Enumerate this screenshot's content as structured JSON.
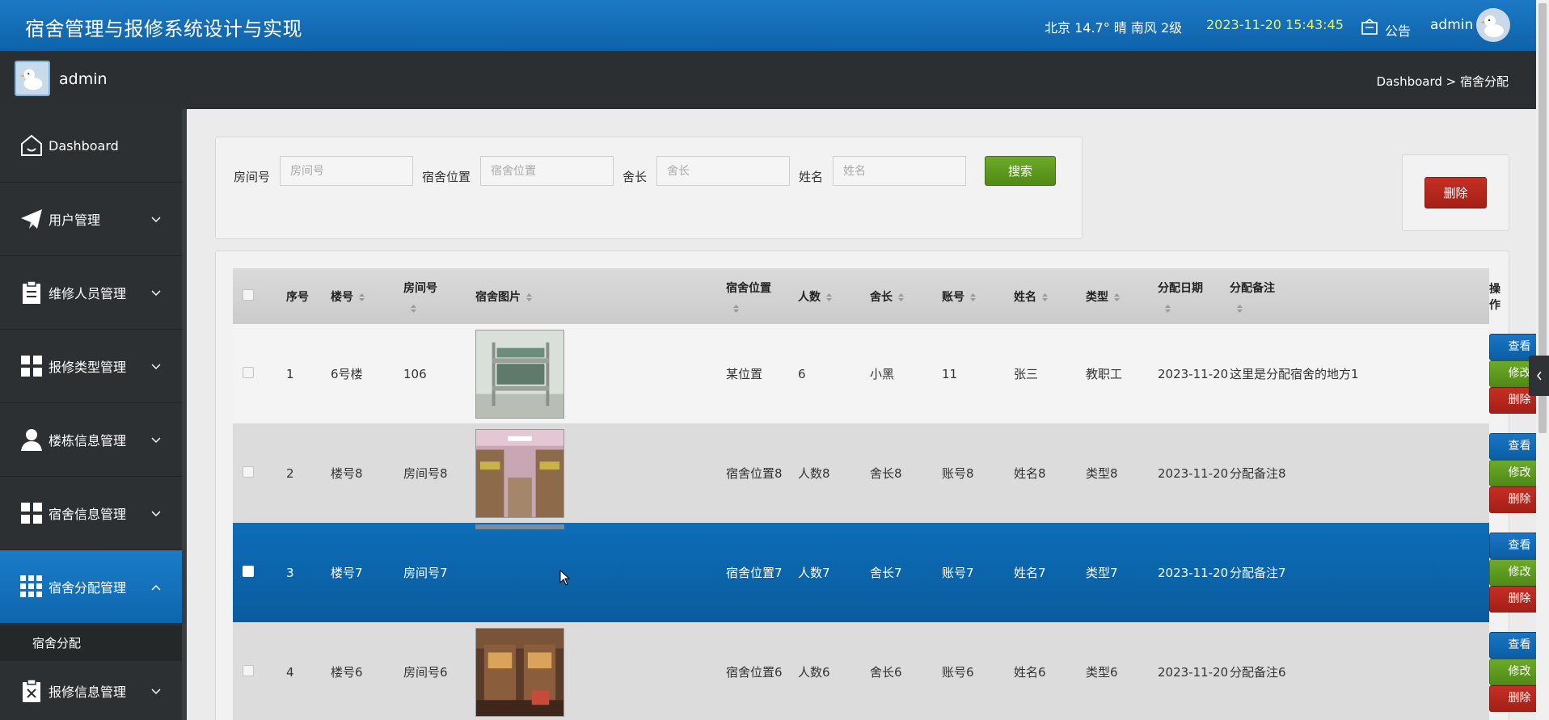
{
  "header": {
    "title": "宿舍管理与报修系统设计与实现",
    "weather": "北京  14.7°  晴  南风  2级",
    "datetime": "2023-11-20 15:43:45",
    "notice_label": "公告",
    "user": "admin"
  },
  "subbar": {
    "user": "admin",
    "breadcrumb": "Dashboard > 宿舍分配"
  },
  "sidebar": {
    "items": [
      {
        "label": "Dashboard",
        "icon": "home-icon"
      },
      {
        "label": "用户管理",
        "icon": "paper-plane-icon"
      },
      {
        "label": "维修人员管理",
        "icon": "clipboard-icon"
      },
      {
        "label": "报修类型管理",
        "icon": "grid-icon"
      },
      {
        "label": "楼栋信息管理",
        "icon": "user-icon"
      },
      {
        "label": "宿舍信息管理",
        "icon": "grid-icon"
      },
      {
        "label": "宿舍分配管理",
        "icon": "apps-icon",
        "active": true
      },
      {
        "label": "报修信息管理",
        "icon": "clipboard-x-icon"
      }
    ],
    "subitem": "宿舍分配"
  },
  "search": {
    "fields": [
      {
        "label": "房间号",
        "placeholder": "房间号"
      },
      {
        "label": "宿舍位置",
        "placeholder": "宿舍位置"
      },
      {
        "label": "舍长",
        "placeholder": "舍长"
      },
      {
        "label": "姓名",
        "placeholder": "姓名"
      }
    ],
    "button": "搜索",
    "delete_button": "删除"
  },
  "table": {
    "headers": [
      "序号",
      "楼号",
      "房间号",
      "宿舍图片",
      "宿舍位置",
      "人数",
      "舍长",
      "账号",
      "姓名",
      "类型",
      "分配日期",
      "分配备注",
      "操作"
    ],
    "actions": {
      "view": "查看",
      "edit": "修改",
      "delete": "删除"
    },
    "rows": [
      {
        "idx": "1",
        "building": "6号楼",
        "room": "106",
        "location": "某位置",
        "count": "6",
        "leader": "小黑",
        "account": "11",
        "name": "张三",
        "type": "教职工",
        "date": "2023-11-20",
        "note": "这里是分配宿舍的地方1"
      },
      {
        "idx": "2",
        "building": "楼号8",
        "room": "房间号8",
        "location": "宿舍位置8",
        "count": "人数8",
        "leader": "舍长8",
        "account": "账号8",
        "name": "姓名8",
        "type": "类型8",
        "date": "2023-11-20",
        "note": "分配备注8"
      },
      {
        "idx": "3",
        "building": "楼号7",
        "room": "房间号7",
        "location": "宿舍位置7",
        "count": "人数7",
        "leader": "舍长7",
        "account": "账号7",
        "name": "姓名7",
        "type": "类型7",
        "date": "2023-11-20",
        "note": "分配备注7"
      },
      {
        "idx": "4",
        "building": "楼号6",
        "room": "房间号6",
        "location": "宿舍位置6",
        "count": "人数6",
        "leader": "舍长6",
        "account": "账号6",
        "name": "姓名6",
        "type": "类型6",
        "date": "2023-11-20",
        "note": "分配备注6"
      }
    ]
  },
  "colors": {
    "primary": "#1672bd",
    "success": "#5e9a1f",
    "danger": "#b3271c",
    "sidebar": "#2d3033"
  }
}
